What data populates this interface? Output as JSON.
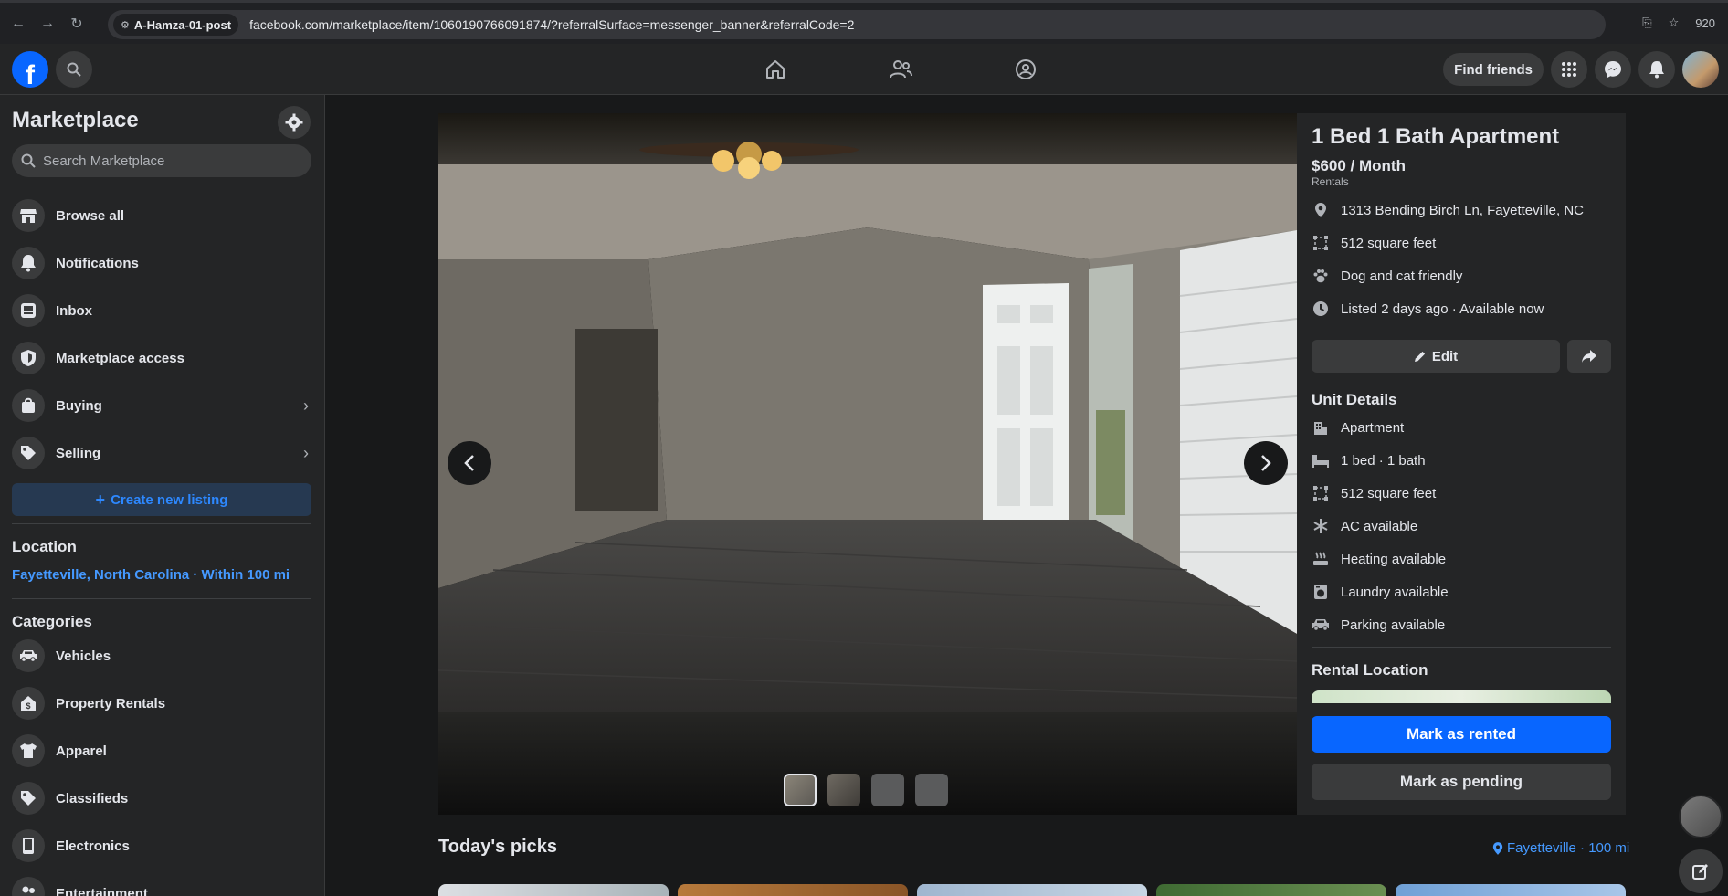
{
  "browser": {
    "profile": "A-Hamza-01-post",
    "url": "facebook.com/marketplace/item/1060190766091874/?referralSurface=messenger_banner&referralCode=2",
    "zoom": "920"
  },
  "topnav": {
    "find_friends": "Find friends",
    "icons": [
      "home-icon",
      "friends-icon",
      "groups-icon",
      "menu-grid-icon",
      "messenger-icon",
      "notifications-icon"
    ]
  },
  "sidebar": {
    "title": "Marketplace",
    "search_placeholder": "Search Marketplace",
    "items": [
      {
        "label": "Browse all",
        "icon": "storefront-icon"
      },
      {
        "label": "Notifications",
        "icon": "bell-icon"
      },
      {
        "label": "Inbox",
        "icon": "inbox-icon"
      },
      {
        "label": "Marketplace access",
        "icon": "shield-icon"
      },
      {
        "label": "Buying",
        "icon": "shopping-bag-icon"
      },
      {
        "label": "Selling",
        "icon": "price-tag-icon"
      }
    ],
    "create_listing": "Create new listing",
    "location_heading": "Location",
    "location_value": "Fayetteville, North Carolina · Within 100 mi",
    "categories_heading": "Categories",
    "categories": [
      {
        "label": "Vehicles",
        "icon": "car-icon"
      },
      {
        "label": "Property Rentals",
        "icon": "house-dollar-icon"
      },
      {
        "label": "Apparel",
        "icon": "shirt-icon"
      },
      {
        "label": "Classifieds",
        "icon": "tag-icon"
      },
      {
        "label": "Electronics",
        "icon": "phone-icon"
      },
      {
        "label": "Entertainment",
        "icon": "people-icon"
      }
    ]
  },
  "listing": {
    "title": "1 Bed 1 Bath Apartment",
    "price": "$600 / Month",
    "category": "Rentals",
    "info": [
      {
        "text": "1313 Bending Birch Ln, Fayetteville, NC",
        "icon": "location-pin-icon"
      },
      {
        "text": "512 square feet",
        "icon": "square-feet-icon"
      },
      {
        "text": "Dog and cat friendly",
        "icon": "paw-icon"
      },
      {
        "text": "Listed 2 days ago · Available now",
        "icon": "clock-icon"
      }
    ],
    "edit_label": "Edit",
    "unit_details_heading": "Unit Details",
    "unit_details": [
      {
        "text": "Apartment",
        "icon": "building-icon"
      },
      {
        "text": "1 bed · 1 bath",
        "icon": "bed-icon"
      },
      {
        "text": "512 square feet",
        "icon": "square-feet-icon"
      },
      {
        "text": "AC available",
        "icon": "snowflake-icon"
      },
      {
        "text": "Heating available",
        "icon": "heating-icon"
      },
      {
        "text": "Laundry available",
        "icon": "washer-icon"
      },
      {
        "text": "Parking available",
        "icon": "car-icon"
      }
    ],
    "rental_location_heading": "Rental Location",
    "mark_rented": "Mark as rented",
    "mark_pending": "Mark as pending"
  },
  "picks": {
    "title": "Today's picks",
    "location": "Fayetteville · 100 mi"
  },
  "colors": {
    "accent": "#0866ff",
    "link": "#4599ff",
    "surface": "#242526",
    "background": "#18191a"
  }
}
